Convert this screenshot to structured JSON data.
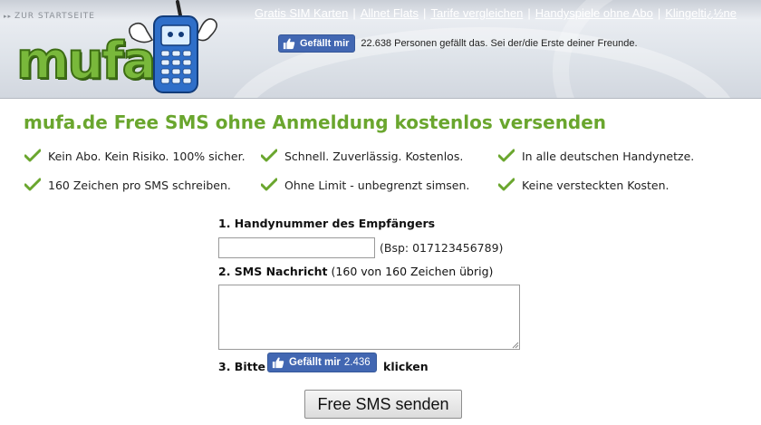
{
  "header": {
    "back_link": "ZUR STARTSEITE",
    "nav": [
      "Gratis SIM Karten",
      "Allnet Flats",
      "Tarife vergleichen",
      "Handyspiele ohne Abo",
      "Klingelti¿½ne"
    ],
    "logo_text": "mufa",
    "like_button": "Gefällt mir",
    "like_text": "22.638 Personen gefällt das. Sei der/die Erste deiner Freunde."
  },
  "main": {
    "title": "mufa.de Free SMS ohne Anmeldung kostenlos versenden",
    "features": [
      "Kein Abo. Kein Risiko. 100% sicher.",
      "Schnell. Zuverlässig. Kostenlos.",
      "In alle deutschen Handynetze.",
      "160 Zeichen pro SMS schreiben.",
      "Ohne Limit - unbegrenzt simsen.",
      "Keine versteckten Kosten."
    ],
    "step1_label": "1. Handynummer des Empfängers",
    "number_value": "",
    "number_hint": "(Bsp: 017123456789)",
    "step2_label": "2. SMS Nachricht",
    "step2_counter": "(160 von 160 Zeichen übrig)",
    "message_value": "",
    "step3_prefix": "3. Bitte",
    "step3_like_label": "Gefällt mir",
    "step3_like_count": "2.436",
    "step3_suffix": "klicken",
    "send_button": "Free SMS senden"
  },
  "colors": {
    "accent_green": "#6aa62e",
    "facebook_blue": "#4267b2"
  },
  "icons": {
    "feature": "checkmark-icon",
    "like": "thumbs-up-icon",
    "mascot": "phone-mascot-icon"
  }
}
